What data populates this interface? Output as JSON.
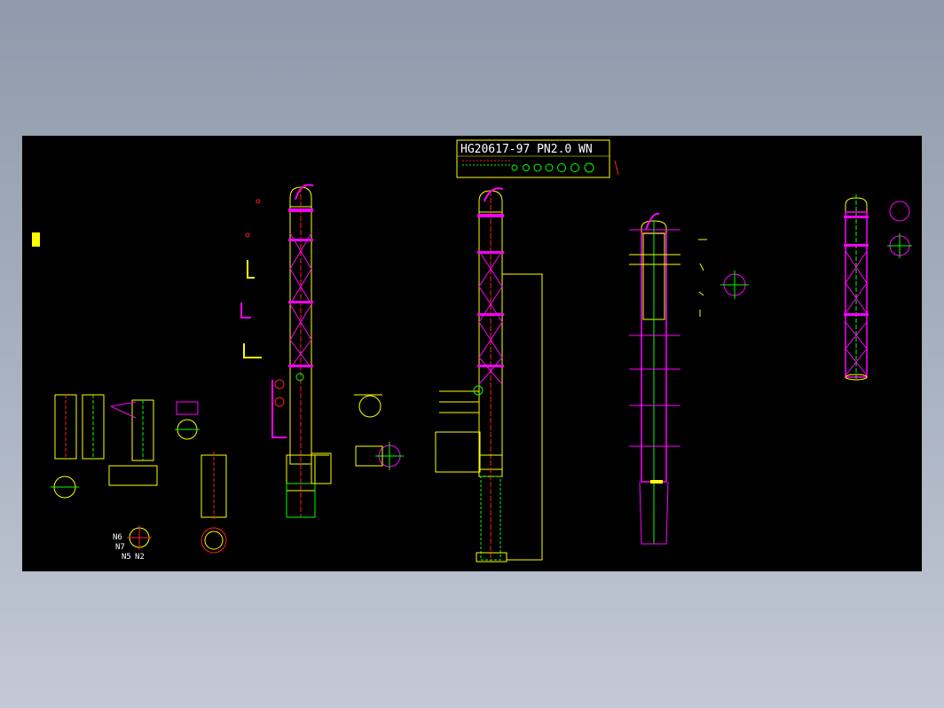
{
  "sheet": {
    "title_block_text": "HG20617-97 PN2.0 WN",
    "nozzle_labels": [
      "N6",
      "N7",
      "N5",
      "N2"
    ]
  },
  "colors": {
    "background": "#000000",
    "viewport_surround": "#9aa5b5",
    "yellow": "#ffff00",
    "magenta": "#ff00ff",
    "red": "#ff2020",
    "green": "#00ff00",
    "cyan": "#00ffff",
    "white": "#ffffff"
  }
}
